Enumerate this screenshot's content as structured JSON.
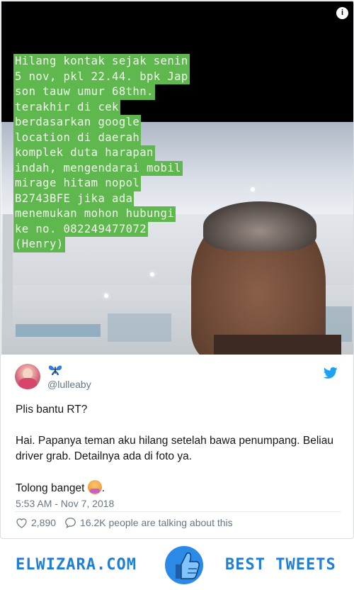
{
  "media": {
    "info_icon_label": "i",
    "overlay_lines": [
      "Hilang kontak sejak senin",
      "5 nov, pkl 22.44. bpk Jap",
      "son tauw umur 68thn.",
      "terakhir di cek",
      "berdasarkan google",
      "location di daerah",
      "komplek duta harapan",
      "indah, mengendarai mobil",
      "mirage hitam nopol",
      "B2743BFE jika ada",
      "menemukan mohon hubungi",
      "ke no. 082249477072",
      "(Henry)"
    ],
    "overlay_color": "#5fb84d"
  },
  "author": {
    "display_name_icon": "butterfly-emoji",
    "handle": "@lulleaby",
    "avatar": "avatar-photo"
  },
  "tweet": {
    "paragraphs": [
      "Plis bantu RT?",
      "Hai. Papanya teman aku hilang setelah bawa penumpang. Beliau driver grab. Detailnya ada di foto ya."
    ],
    "last_line_text": "Tolong banget ",
    "last_line_emoji": "person-raising-hand-emoji",
    "last_line_suffix": ".",
    "timestamp": "5:53 AM - Nov 7, 2018",
    "like_count": "2,890",
    "talking_text": "16.2K people are talking about this"
  },
  "footer": {
    "brand": "ELWIZARA.COM",
    "tagline": "BEST TWEETS",
    "thumb_icon": "thumbs-up-icon",
    "accent_color": "#1f7fd8"
  },
  "icons": {
    "twitter": "twitter-bird-icon",
    "heart": "heart-icon",
    "reply": "speech-bubble-icon"
  }
}
